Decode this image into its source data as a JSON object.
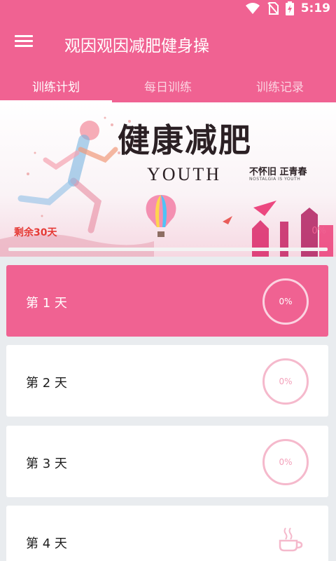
{
  "status": {
    "time": "5:19",
    "icons": [
      "wifi-icon",
      "no-sim-icon",
      "battery-charging-icon"
    ]
  },
  "app": {
    "title": "观因观因减肥健身操",
    "menu_icon": "hamburger-menu-icon"
  },
  "tabs": [
    {
      "label": "训练计划",
      "active": true
    },
    {
      "label": "每日训练",
      "active": false
    },
    {
      "label": "训练记录",
      "active": false
    }
  ],
  "banner": {
    "title": "健康减肥",
    "youth": "YOUTH",
    "slogan": "不怀旧 正青春",
    "slogan_sub": "NOSTALGIA IS YOUTH",
    "remaining": "剩余30天",
    "progress_label": "0%",
    "progress": 0
  },
  "days": [
    {
      "label": "第 1 天",
      "progress": "0%",
      "active": true,
      "icon": "progress-ring"
    },
    {
      "label": "第 2 天",
      "progress": "0%",
      "active": false,
      "icon": "progress-ring"
    },
    {
      "label": "第 3 天",
      "progress": "0%",
      "active": false,
      "icon": "progress-ring"
    },
    {
      "label": "第 4 天",
      "progress": "",
      "active": false,
      "icon": "coffee-cup-icon"
    }
  ],
  "colors": {
    "primary": "#f06292",
    "ring": "#f5b9cc",
    "background": "#e9ecef"
  }
}
